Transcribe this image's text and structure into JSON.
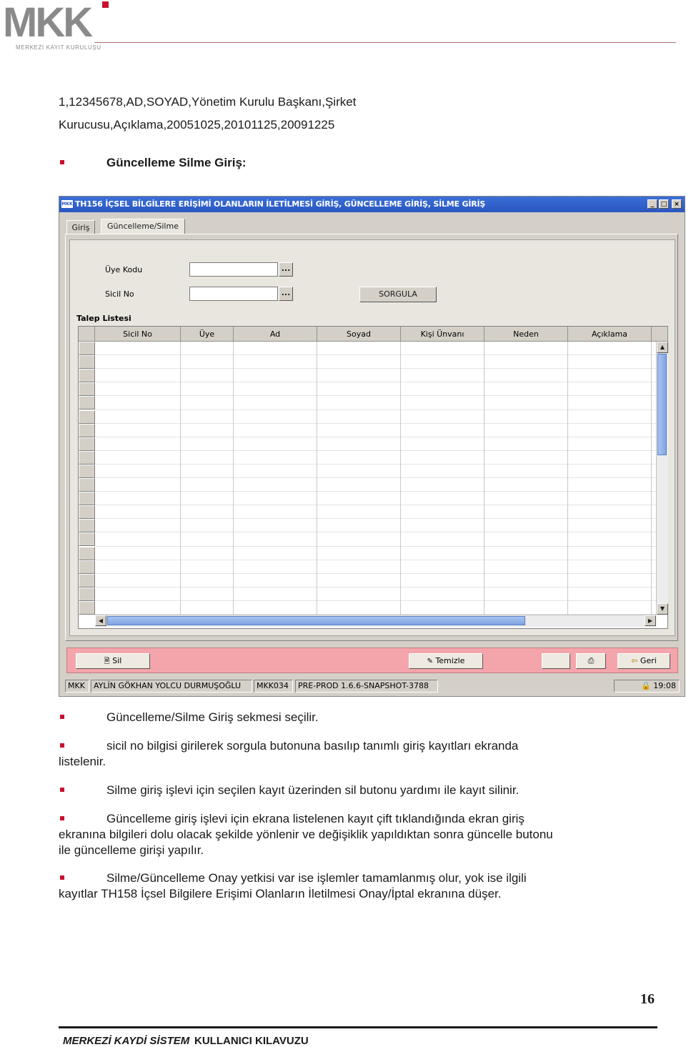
{
  "header": {
    "logo_text": "MKK",
    "logo_subtitle": "MERKEZİ KAYIT KURULUŞU",
    "accent_color": "#c8102e"
  },
  "intro_text": {
    "line1": "1,12345678,AD,SOYAD,Yönetim Kurulu Başkanı,Şirket",
    "line2": "Kurucusu,Açıklama,20051025,20101125,20091225"
  },
  "section_heading": "Güncelleme Silme Giriş:",
  "app": {
    "window_title": "TH156 İÇSEL BİLGİLERE ERİŞİMİ OLANLARIN İLETİLMESİ GİRİŞ, GÜNCELLEME GİRİŞ, SİLME GİRİŞ",
    "window_icon_label": "MKK",
    "window_buttons": {
      "minimize": "_",
      "maximize": "□",
      "close": "×"
    },
    "tabs": [
      {
        "label": "Giriş"
      },
      {
        "label": "Güncelleme/Silme"
      }
    ],
    "form": {
      "uye_kodu_label": "Üye Kodu",
      "sicil_no_label": "Sicil No",
      "uye_kodu_value": "",
      "sicil_no_value": "",
      "lookup_button": "...",
      "query_button": "SORGULA"
    },
    "list_title": "Talep Listesi",
    "table_columns": [
      "Sicil No",
      "Üye",
      "Ad",
      "Soyad",
      "Kişi Ünvanı",
      "Neden",
      "Açıklama"
    ],
    "table_rows": [],
    "actions": {
      "delete": "Sil",
      "clear": "Temizle",
      "back": "Geri"
    },
    "status_bar": {
      "system": "MKK",
      "user": "AYLİN GÖKHAN YOLCU DURMUŞOĞLU",
      "member_code": "MKK034",
      "version": "PRE-PROD 1.6.6-SNAPSHOT-3788",
      "time": "19:08"
    }
  },
  "bullets": [
    {
      "text": "Güncelleme/Silme Giriş sekmesi seçilir."
    },
    {
      "line1": "sicil no  bilgisi  girilerek sorgula butonuna basılıp tanımlı giriş kayıtları ekranda",
      "line2": "listelenir."
    },
    {
      "text": "Silme giriş işlevi için seçilen kayıt üzerinden sil butonu yardımı ile kayıt silinir."
    },
    {
      "line1": "Güncelleme giriş işlevi için ekrana listelenen kayıt çift tıklandığında ekran giriş",
      "line2": "ekranına bilgileri dolu olacak şekilde yönlenir ve değişiklik yapıldıktan sonra güncelle butonu",
      "line3": "ile güncelleme girişi yapılır."
    },
    {
      "line1": "Silme/Güncelleme Onay yetkisi var ise işlemler tamamlanmış olur, yok ise ilgili",
      "line2": "kayıtlar TH158 İçsel Bilgilere Erişimi Olanların İletilmesi Onay/İptal ekranına düşer."
    }
  ],
  "page_number": "16",
  "footer": {
    "left": "MERKEZİ KAYDİ SİSTEM",
    "right": "KULLANICI KILAVUZU"
  }
}
